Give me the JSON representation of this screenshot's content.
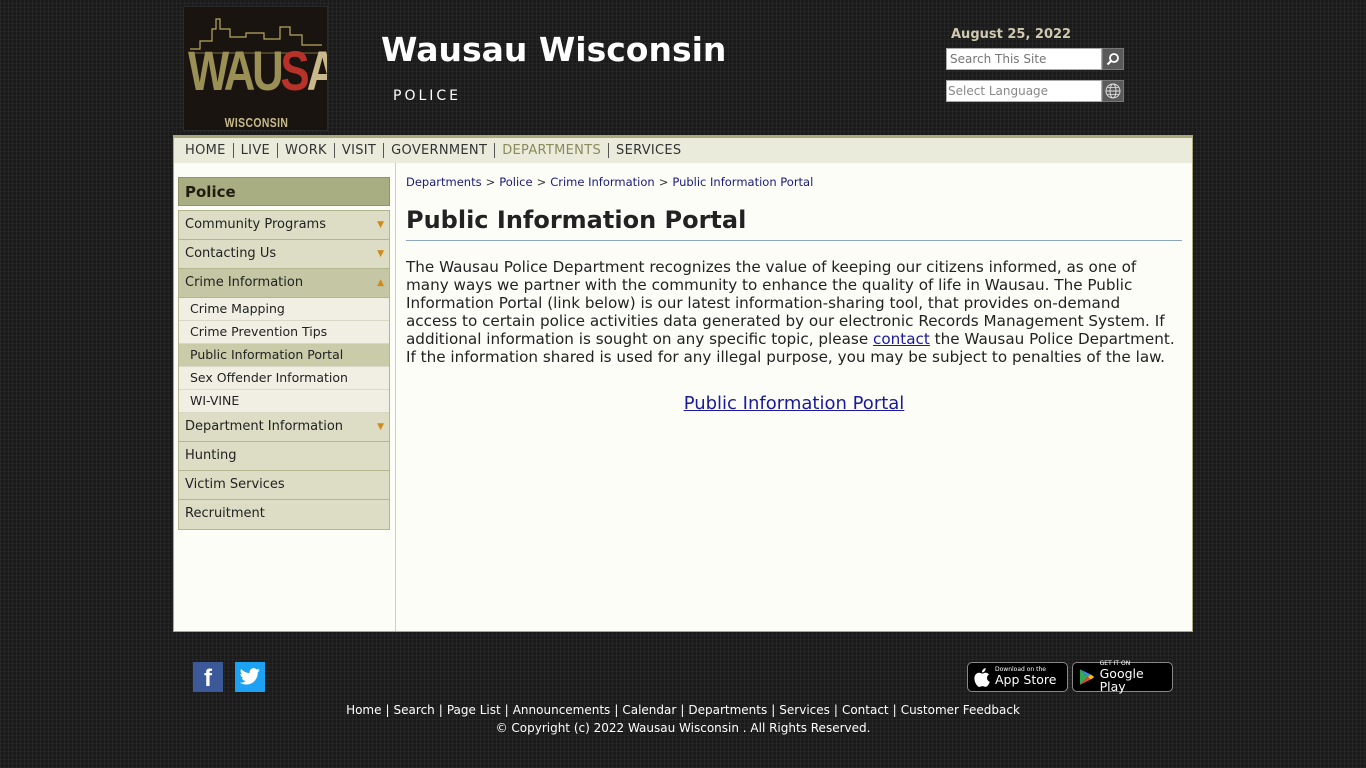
{
  "header": {
    "logo_text_1": "WAU",
    "logo_text_2": "S",
    "logo_text_3": "AU",
    "logo_sub": "WISCONSIN",
    "site_title": "Wausau Wisconsin",
    "site_subtitle": "POLICE",
    "date": "August 25, 2022",
    "search_placeholder": "Search This Site",
    "language_label": "Select Language"
  },
  "nav": {
    "items": [
      "HOME",
      "LIVE",
      "WORK",
      "VISIT",
      "GOVERNMENT",
      "DEPARTMENTS",
      "SERVICES"
    ],
    "active": "DEPARTMENTS"
  },
  "sidebar": {
    "title": "Police",
    "items": [
      {
        "label": "Community Programs"
      },
      {
        "label": "Contacting Us"
      },
      {
        "label": "Crime Information"
      },
      {
        "label": "Department Information"
      },
      {
        "label": "Hunting"
      },
      {
        "label": "Victim Services"
      },
      {
        "label": "Recruitment"
      }
    ],
    "sub_items": [
      {
        "label": "Crime Mapping"
      },
      {
        "label": "Crime Prevention Tips"
      },
      {
        "label": "Public Information Portal"
      },
      {
        "label": "Sex Offender Information"
      },
      {
        "label": "WI-VINE"
      }
    ]
  },
  "breadcrumb": [
    "Departments",
    "Police",
    "Crime Information",
    "Public Information Portal"
  ],
  "content": {
    "title": "Public Information Portal",
    "text_before_link": "The Wausau Police Department recognizes the value of keeping our citizens informed, as one of many ways we partner with the community to enhance the quality of life in Wausau. The Public Information Portal (link below) is our latest information-sharing tool, that provides on-demand access to certain police activities data generated by our electronic Records Management System. If additional information is sought on any specific topic, please ",
    "link_text": "contact",
    "text_after_link": " the Wausau Police Department. If the information shared is used for any illegal purpose, you may be subject to penalties of the law.",
    "portal_link": "Public Information Portal"
  },
  "footer": {
    "app_store_small": "Download on the",
    "app_store_big": "App Store",
    "google_small": "GET IT ON",
    "google_big": "Google Play",
    "links": [
      "Home",
      "Search",
      "Page List",
      "Announcements",
      "Calendar",
      "Departments",
      "Services",
      "Contact",
      "Customer Feedback"
    ],
    "copyright": "© Copyright (c) 2022 Wausau Wisconsin . All Rights Reserved."
  },
  "colors": {
    "nav_active": "#8a8a5a",
    "sidebar_title_bg": "#a9ad82",
    "link": "#1a1a9a",
    "facebook": "#3b5998",
    "twitter": "#1da1f2"
  }
}
